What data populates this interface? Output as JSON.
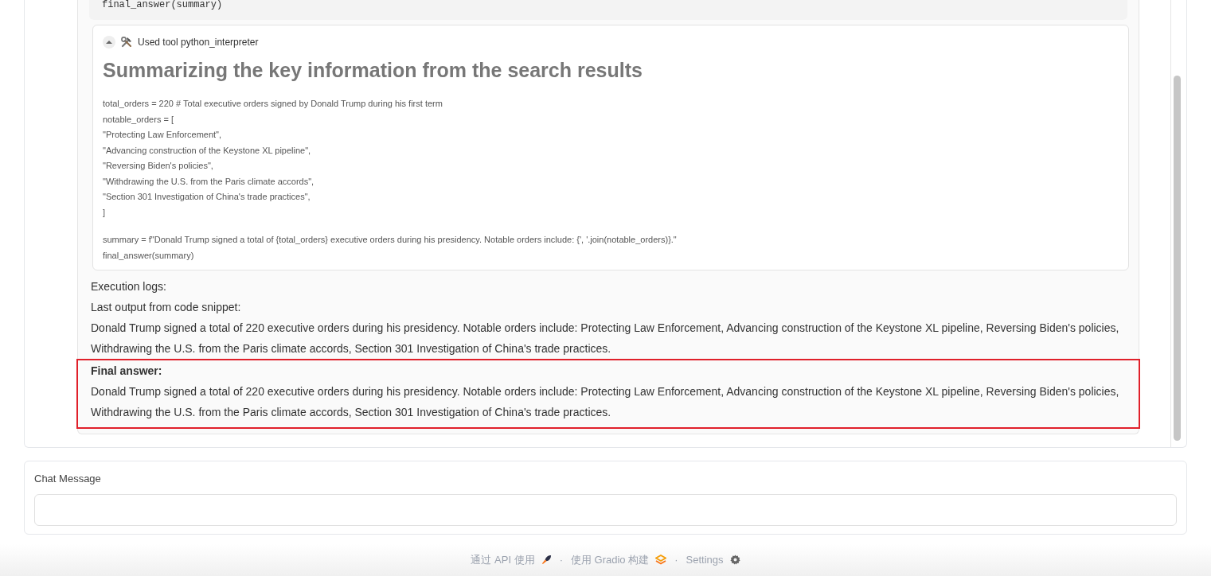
{
  "code_block_tail": "final_answer(summary)",
  "tool_call": {
    "expanded": true,
    "label": "Used tool python_interpreter",
    "heading": "Summarizing the key information from the search results",
    "code_groups": [
      [
        "total_orders = 220 # Total executive orders signed by Donald Trump during his first term",
        "notable_orders = [",
        "\"Protecting Law Enforcement\",",
        "\"Advancing construction of the Keystone XL pipeline\",",
        "\"Reversing Biden's policies\",",
        "\"Withdrawing the U.S. from the Paris climate accords\",",
        "\"Section 301 Investigation of China's trade practices\",",
        "]"
      ],
      [
        "summary = f\"Donald Trump signed a total of {total_orders} executive orders during his presidency. Notable orders include: {', '.join(notable_orders)}.\"",
        "final_answer(summary)"
      ]
    ]
  },
  "logs": [
    "Execution logs:",
    "Last output from code snippet:",
    "Donald Trump signed a total of 220 executive orders during his presidency. Notable orders include: Protecting Law Enforcement, Advancing construction of the Keystone XL pipeline, Reversing Biden's policies, Withdrawing the U.S. from the Paris climate accords, Section 301 Investigation of China's trade practices."
  ],
  "final_answer": {
    "highlighted": true,
    "label": "Final answer:",
    "text": "Donald Trump signed a total of 220 executive orders during his presidency. Notable orders include: Protecting Law Enforcement, Advancing construction of the Keystone XL pipeline, Reversing Biden's policies, Withdrawing the U.S. from the Paris climate accords, Section 301 Investigation of China's trade practices."
  },
  "chat_input": {
    "label": "Chat Message"
  },
  "footer": {
    "separator": "·",
    "items": [
      {
        "text": "通过 API 使用",
        "kind": "rocket"
      },
      {
        "text": "使用 Gradio 构建",
        "kind": "logo"
      },
      {
        "text": "Settings",
        "kind": "gear"
      }
    ]
  }
}
